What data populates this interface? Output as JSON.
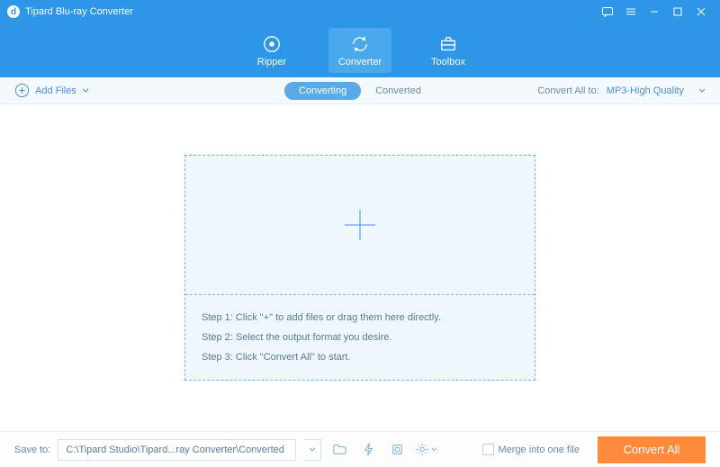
{
  "titlebar": {
    "title": "Tipard Blu-ray Converter"
  },
  "nav": {
    "ripper": "Ripper",
    "converter": "Converter",
    "toolbox": "Toolbox"
  },
  "optbar": {
    "add_files": "Add Files",
    "tab_converting": "Converting",
    "tab_converted": "Converted",
    "convert_all_to": "Convert All to:",
    "format": "MP3-High Quality"
  },
  "dropzone": {
    "step1": "Step 1: Click \"+\" to add files or drag them here directly.",
    "step2": "Step 2: Select the output format you desire.",
    "step3": "Step 3: Click \"Convert All\" to start."
  },
  "footer": {
    "save_to": "Save to:",
    "path": "C:\\Tipard Studio\\Tipard...ray Converter\\Converted",
    "merge": "Merge into one file",
    "convert_all": "Convert All"
  }
}
